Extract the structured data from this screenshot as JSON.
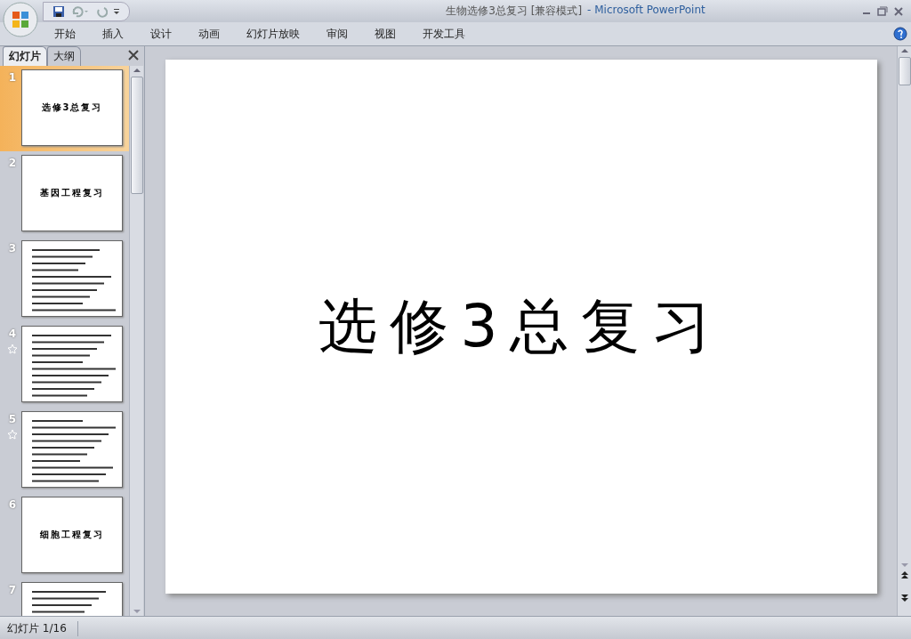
{
  "window": {
    "title": "生物选修3总复习 [兼容模式]",
    "app_name": "- Microsoft PowerPoint"
  },
  "ribbon_tabs": [
    "开始",
    "插入",
    "设计",
    "动画",
    "幻灯片放映",
    "审阅",
    "视图",
    "开发工具"
  ],
  "pane_tabs": [
    {
      "label": "幻灯片",
      "selected": true
    },
    {
      "label": "大纲",
      "selected": false
    }
  ],
  "slides": [
    {
      "number": "1",
      "kind": "title",
      "title": "选修3总复习",
      "selected": true,
      "animated": false
    },
    {
      "number": "2",
      "kind": "title",
      "title": "基因工程复习",
      "selected": false,
      "animated": false
    },
    {
      "number": "3",
      "kind": "text",
      "selected": false,
      "animated": false
    },
    {
      "number": "4",
      "kind": "text",
      "selected": false,
      "animated": true
    },
    {
      "number": "5",
      "kind": "text",
      "selected": false,
      "animated": true
    },
    {
      "number": "6",
      "kind": "title",
      "title": "细胞工程复习",
      "selected": false,
      "animated": false
    },
    {
      "number": "7",
      "kind": "text",
      "selected": false,
      "animated": false
    }
  ],
  "slide": {
    "title": "选修3总复习"
  },
  "status_bar": {
    "slide_counter": "幻灯片 1/16"
  }
}
